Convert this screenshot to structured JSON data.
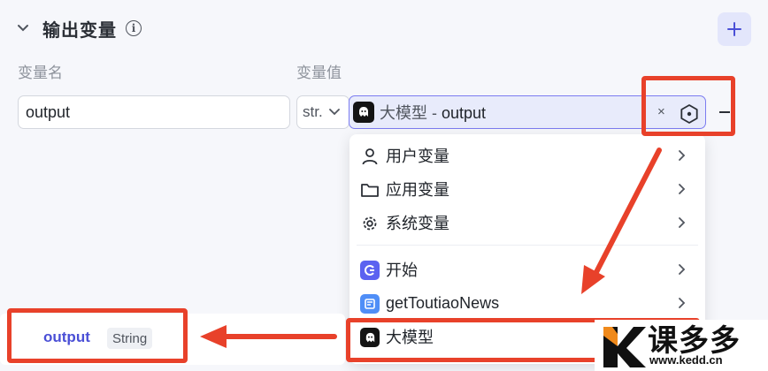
{
  "header": {
    "title": "输出变量"
  },
  "columns": {
    "name_label": "变量名",
    "value_label": "变量值"
  },
  "row": {
    "name_value": "output",
    "type_value": "str.",
    "ref_source": "大模型",
    "ref_sep": " - ",
    "ref_var": "output",
    "clear_glyph": "×"
  },
  "menu": {
    "items": [
      {
        "label": "用户变量",
        "icon": "user-icon"
      },
      {
        "label": "应用变量",
        "icon": "folder-icon"
      },
      {
        "label": "系统变量",
        "icon": "gear-icon"
      },
      {
        "label": "开始",
        "icon": "start-node-icon"
      },
      {
        "label": "getToutiaoNews",
        "icon": "news-node-icon"
      },
      {
        "label": "大模型",
        "icon": "llm-node-icon"
      }
    ]
  },
  "output_tag": {
    "name": "output",
    "type": "String"
  },
  "watermark": {
    "text": "课多多",
    "url": "www.kedd.cn"
  },
  "colors": {
    "accent": "#4a4fd6",
    "annotation": "#e8412a",
    "selected_bg": "#e8ebfb"
  }
}
